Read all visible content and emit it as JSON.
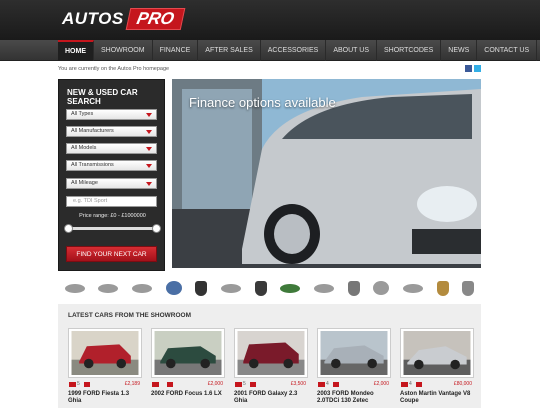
{
  "brand": {
    "name_a": "AUTOS",
    "name_b": "PRO"
  },
  "nav": [
    "HOME",
    "SHOWROOM",
    "FINANCE",
    "AFTER SALES",
    "ACCESSORIES",
    "ABOUT US",
    "SHORTCODES",
    "NEWS",
    "CONTACT US"
  ],
  "crumb": "You are currently on the Autos Pro homepage",
  "search": {
    "title": "NEW & USED CAR SEARCH",
    "selects": [
      "All Types",
      "All Manufacturers",
      "All Models",
      "All Transmissions",
      "All Mileage"
    ],
    "text_placeholder": "e.g. TDI Sport",
    "price_label": "Price range: £0 - £1000000",
    "price_range": [
      0,
      1000000
    ],
    "button": "FIND YOUR NEXT CAR"
  },
  "hero": {
    "title": "Finance options available"
  },
  "brands": [
    "aston-martin",
    "audi",
    "bentley",
    "bmw",
    "ferrari",
    "jaguar",
    "lamborghini",
    "land-rover",
    "lexus",
    "maserati",
    "mercedes",
    "mini",
    "porsche",
    "rolls-royce"
  ],
  "latest": {
    "title": "LATEST CARS FROM THE SHOWROOM",
    "cars": [
      {
        "photos": "5",
        "price": "£2,189",
        "name": "1999 FORD Fiesta 1.3 Ghia",
        "color": "#b1202b"
      },
      {
        "photos": "",
        "price": "£2,000",
        "name": "2002 FORD Focus 1.6 LX",
        "color": "#2c4b3f"
      },
      {
        "photos": "5",
        "price": "£3,500",
        "name": "2001 FORD Galaxy 2.3 Ghia",
        "color": "#7a1a2a"
      },
      {
        "photos": "4",
        "price": "£2,000",
        "name": "2003 FORD Mondeo 2.0TDCi 130 Zetec",
        "color": "#a8b0b8"
      },
      {
        "photos": "4",
        "price": "£80,000",
        "name": "Aston Martin Vantage V8 Coupe",
        "color": "#c9ccd0"
      }
    ]
  },
  "colors": {
    "accent": "#c5161d",
    "panel": "#2b2b2b",
    "header": "#1a1a1a"
  }
}
